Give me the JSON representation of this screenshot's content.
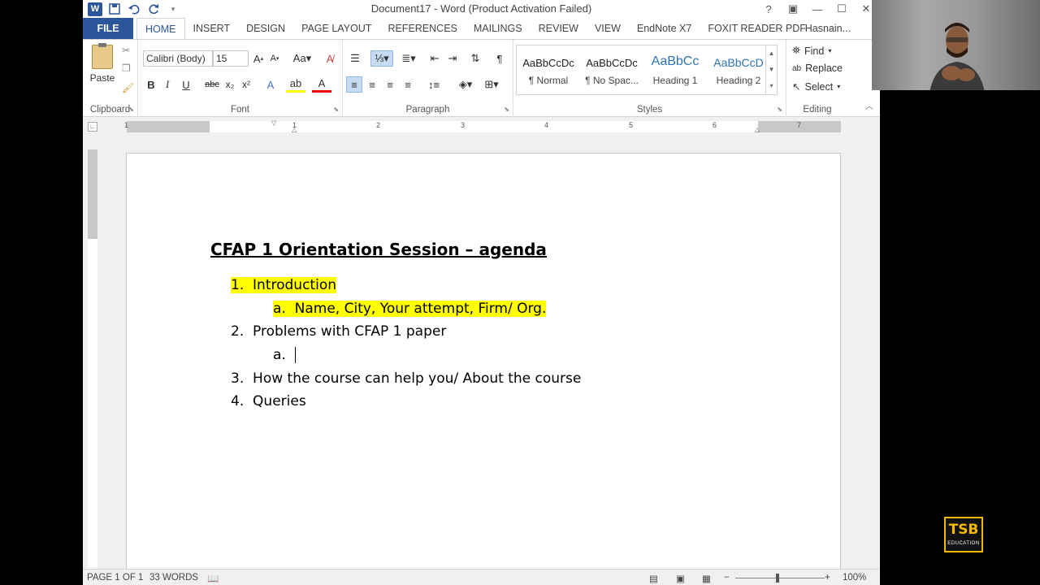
{
  "window": {
    "title": "Document17 - Word (Product Activation Failed)",
    "controls": [
      "?",
      "▣",
      "—",
      "☐",
      "✕"
    ]
  },
  "qat": {
    "logo": "W",
    "save_icon": "💾",
    "undo_icon": "↶",
    "redo_icon": "↻"
  },
  "tabs": [
    "FILE",
    "HOME",
    "INSERT",
    "DESIGN",
    "PAGE LAYOUT",
    "REFERENCES",
    "MAILINGS",
    "REVIEW",
    "VIEW",
    "EndNote X7",
    "FOXIT READER PDF"
  ],
  "account": "Hasnain...",
  "ribbon": {
    "clipboard": {
      "label": "Clipboard",
      "paste": "Paste"
    },
    "font": {
      "label": "Font",
      "font_name": "Calibri (Body)",
      "font_size": "15"
    },
    "paragraph": {
      "label": "Paragraph"
    },
    "styles": {
      "label": "Styles",
      "items": [
        {
          "sample": "AaBbCcDc",
          "name": "¶ Normal"
        },
        {
          "sample": "AaBbCcDc",
          "name": "¶ No Spac..."
        },
        {
          "sample": "AaBbCc",
          "name": "Heading 1"
        },
        {
          "sample": "AaBbCcD",
          "name": "Heading 2"
        }
      ]
    },
    "editing": {
      "label": "Editing",
      "find": "Find",
      "replace": "Replace",
      "select": "Select"
    }
  },
  "ruler": {
    "numbers": [
      "1",
      "1",
      "2",
      "3",
      "4",
      "5",
      "6",
      "7"
    ]
  },
  "document": {
    "title": "CFAP 1 Orientation Session – agenda",
    "items": [
      {
        "num": "1.",
        "text": "Introduction",
        "highlight": true
      },
      {
        "num": "a.",
        "text": "Name, City, Your attempt, Firm/ Org.",
        "highlight": true,
        "sub": true
      },
      {
        "num": "2.",
        "text": "Problems with CFAP 1 paper"
      },
      {
        "num": "a.",
        "text": "",
        "sub": true,
        "cursor": true
      },
      {
        "num": "3.",
        "text": "How the course can help you/ About the course"
      },
      {
        "num": "4.",
        "text": "Queries"
      }
    ]
  },
  "status": {
    "page": "PAGE 1 OF 1",
    "words": "33 WORDS",
    "zoom": "100%",
    "zoom_level": 1.0
  },
  "logo": {
    "main": "TSB",
    "sub": "EDUCATION"
  },
  "colors": {
    "accent": "#2b579a",
    "highlight": "#ffff00",
    "logo": "#f5b800"
  }
}
